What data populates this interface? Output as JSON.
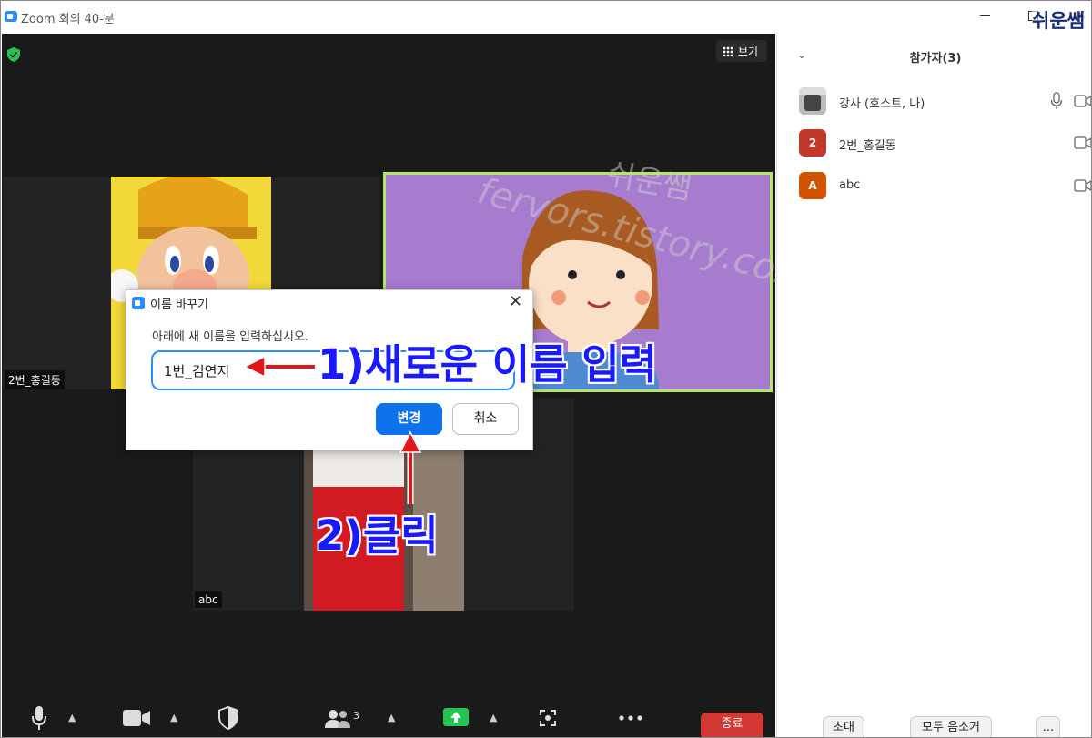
{
  "window": {
    "title": "Zoom 회의 40-분"
  },
  "watermark": {
    "top_label": "쉬운쌤",
    "url": "fervors.tistory.com",
    "name": "쉬운쌤"
  },
  "meeting": {
    "view_button": "보기",
    "tiles": [
      {
        "name": "2번_홍길동"
      },
      {
        "name": ""
      },
      {
        "name": "abc"
      }
    ]
  },
  "dialog": {
    "title": "이름 바꾸기",
    "prompt": "아래에 새 이름을 입력하십시오.",
    "input_value": "1번_김연지",
    "change_label": "변경",
    "cancel_label": "취소"
  },
  "annotations": {
    "step1": "1)새로운 이름 입력",
    "step2": "2)클릭"
  },
  "toolbar": {
    "participants_count": "3",
    "end_label": "종료"
  },
  "participants_panel": {
    "title": "참가자(3)",
    "participants": [
      {
        "name": "강사 (호스트, 나)",
        "avatar_letter": "",
        "avatar_color": "#888888"
      },
      {
        "name": "2번_홍길동",
        "avatar_letter": "2",
        "avatar_color": "#c0392b"
      },
      {
        "name": "abc",
        "avatar_letter": "A",
        "avatar_color": "#d35400"
      }
    ],
    "invite_label": "초대",
    "mute_all_label": "모두 음소거",
    "more_label": "..."
  },
  "colors": {
    "accent": "#0e72ed",
    "end": "#d33a36",
    "annotation": "#1a1aff",
    "arrow": "#e0161b"
  }
}
